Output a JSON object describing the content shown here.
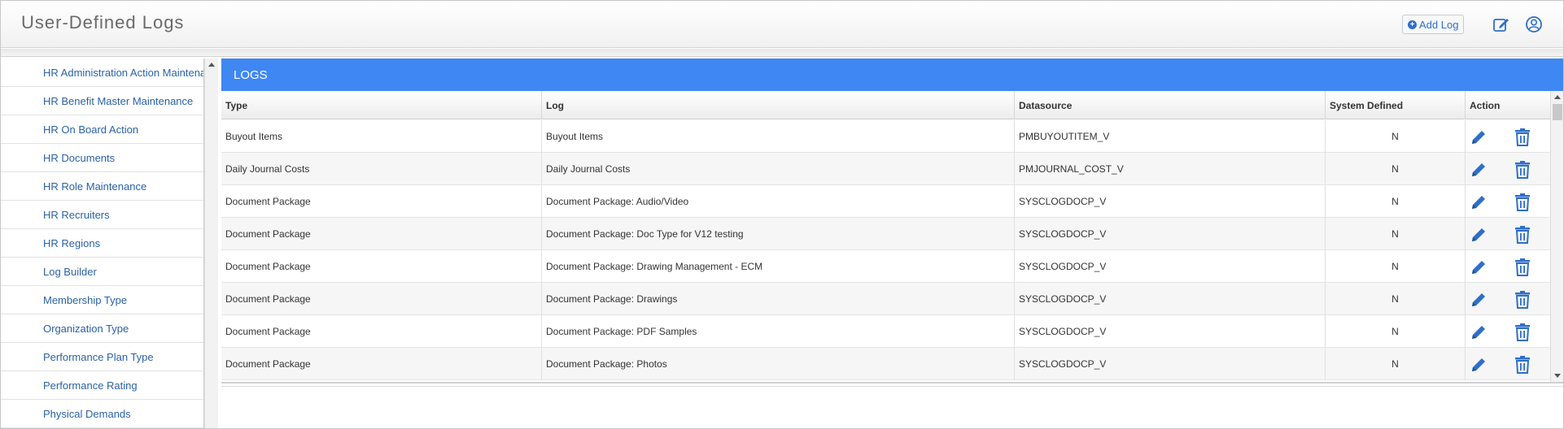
{
  "app": {
    "title": "User-Defined Logs",
    "add_log_label": "Add Log",
    "accent_color": "#3f87f3"
  },
  "icons": {
    "add": "plus-circle-icon",
    "edit_page": "edit-icon",
    "user": "user-circle-icon",
    "row_edit": "pencil-icon",
    "row_delete": "trash-icon"
  },
  "sidebar": {
    "items": [
      {
        "label": "HR Administration Action Maintena"
      },
      {
        "label": "HR Benefit Master Maintenance"
      },
      {
        "label": "HR On Board Action"
      },
      {
        "label": "HR Documents"
      },
      {
        "label": "HR Role Maintenance"
      },
      {
        "label": "HR Recruiters"
      },
      {
        "label": "HR Regions"
      },
      {
        "label": "Log Builder"
      },
      {
        "label": "Membership Type"
      },
      {
        "label": "Organization Type"
      },
      {
        "label": "Performance Plan Type"
      },
      {
        "label": "Performance Rating"
      },
      {
        "label": "Physical Demands"
      }
    ]
  },
  "logs": {
    "heading": "LOGS",
    "columns": {
      "type": "Type",
      "log": "Log",
      "datasource": "Datasource",
      "system_defined": "System Defined",
      "action": "Action"
    },
    "rows": [
      {
        "type": "Buyout Items",
        "log": "Buyout Items",
        "datasource": "PMBUYOUTITEM_V",
        "system_defined": "N"
      },
      {
        "type": "Daily Journal Costs",
        "log": "Daily Journal Costs",
        "datasource": "PMJOURNAL_COST_V",
        "system_defined": "N"
      },
      {
        "type": "Document Package",
        "log": "Document Package: Audio/Video",
        "datasource": "SYSCLOGDOCP_V",
        "system_defined": "N"
      },
      {
        "type": "Document Package",
        "log": "Document Package: Doc Type for V12 testing",
        "datasource": "SYSCLOGDOCP_V",
        "system_defined": "N"
      },
      {
        "type": "Document Package",
        "log": "Document Package: Drawing Management - ECM",
        "datasource": "SYSCLOGDOCP_V",
        "system_defined": "N"
      },
      {
        "type": "Document Package",
        "log": "Document Package: Drawings",
        "datasource": "SYSCLOGDOCP_V",
        "system_defined": "N"
      },
      {
        "type": "Document Package",
        "log": "Document Package: PDF Samples",
        "datasource": "SYSCLOGDOCP_V",
        "system_defined": "N"
      },
      {
        "type": "Document Package",
        "log": "Document Package: Photos",
        "datasource": "SYSCLOGDOCP_V",
        "system_defined": "N"
      }
    ]
  }
}
